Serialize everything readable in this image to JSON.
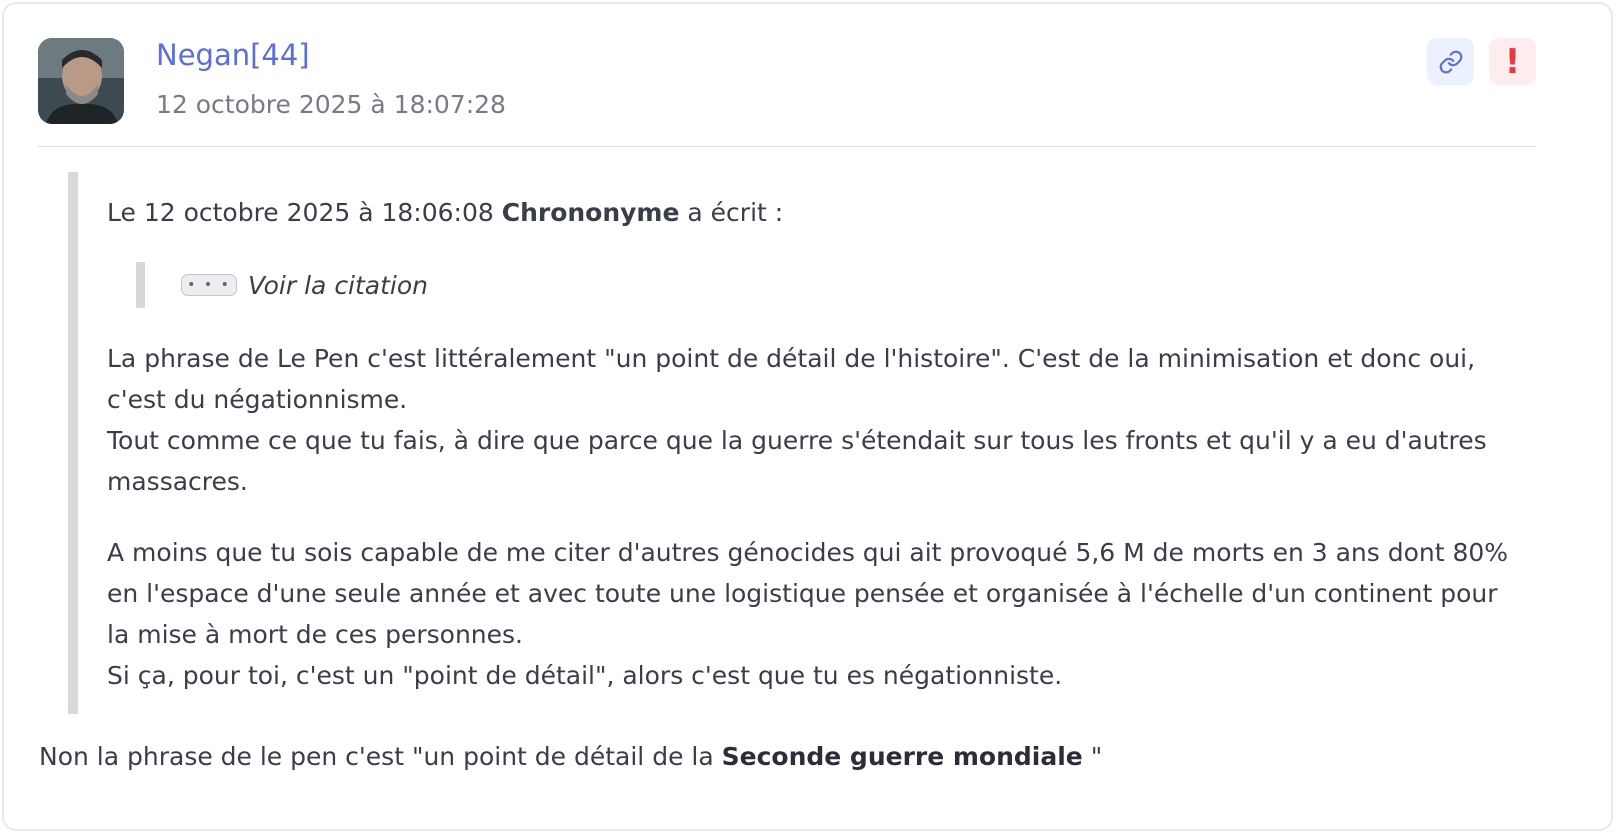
{
  "post": {
    "author": "Negan[44]",
    "timestamp": "12 octobre 2025 à 18:07:28",
    "avatar_icon": "user-avatar-photo"
  },
  "actions": {
    "link_icon": "link-icon",
    "report_icon": "report-icon",
    "report_glyph": "!"
  },
  "quote": {
    "prefix": "Le 12 octobre 2025 à 18:06:08",
    "author": "Chrononyme",
    "suffix": "a écrit :",
    "nested": {
      "dots": "• • •",
      "label": "Voir la citation"
    },
    "paragraph1": "La phrase de Le Pen c'est littéralement \"un point de détail de l'histoire\". C'est de la minimisation et donc oui, c'est du négationnisme.\nTout comme ce que tu fais, à dire que parce que la guerre s'étendait sur tous les fronts et qu'il y a eu d'autres massacres.",
    "paragraph2": "A moins que tu sois capable de me citer d'autres génocides qui ait provoqué 5,6 M de morts en 3 ans dont 80% en l'espace d'une seule année et avec toute une logistique pensée et organisée à l'échelle d'un continent pour la mise à mort de ces personnes.\nSi ça, pour toi, c'est un \"point de détail\", alors c'est que tu es négationniste."
  },
  "reply": {
    "text_before": "Non la phrase de le pen c'est \"un point de détail de la ",
    "bold": "Seconde guerre mondiale",
    "text_after": " \""
  },
  "colors": {
    "author": "#5a6fdc",
    "report": "#e53944",
    "link_bg": "#ebf1ff",
    "report_bg": "#feecee"
  }
}
